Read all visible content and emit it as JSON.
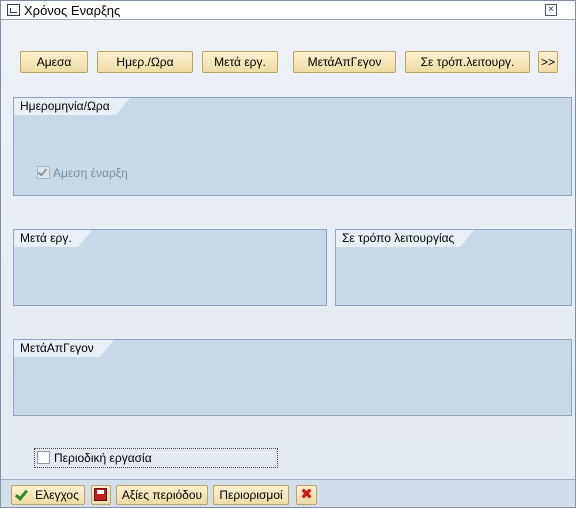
{
  "window": {
    "title": "Χρόνος Εναρξης",
    "close_symbol": "×"
  },
  "toolbar": {
    "immediate": "Αμεσα",
    "date_time": "Ημερ./Ωρα",
    "after_job": "Μετά εργ.",
    "after_event": "ΜετάΑπΓεγον",
    "operation_mode": "Σε τρόπ.λειτουργ.",
    "more": ">>"
  },
  "date_time_group": {
    "title": "Ημερομηνία/Ωρα",
    "immediate_start": {
      "label": "Αμεση έναρξη",
      "checked": true,
      "disabled": true
    }
  },
  "after_job_group": {
    "title": "Μετά εργ."
  },
  "operation_mode_group": {
    "title": "Σε τρόπο λειτουργίας"
  },
  "after_event_group": {
    "title": "ΜετάΑπΓεγον"
  },
  "periodic": {
    "label": "Περιοδική εργασία",
    "checked": false
  },
  "footer": {
    "check": "Ελεγχος",
    "period_values": "Αξίες περιόδου",
    "restrictions": "Περιορισμοί"
  },
  "icons": {
    "check_icon": "check-icon",
    "save_icon": "save-icon",
    "cancel_icon": "cancel-icon"
  },
  "colors": {
    "group_bg": "#c9d8e9",
    "button_bg": "#f5e6b8",
    "footer_bg": "#d3deeb"
  }
}
